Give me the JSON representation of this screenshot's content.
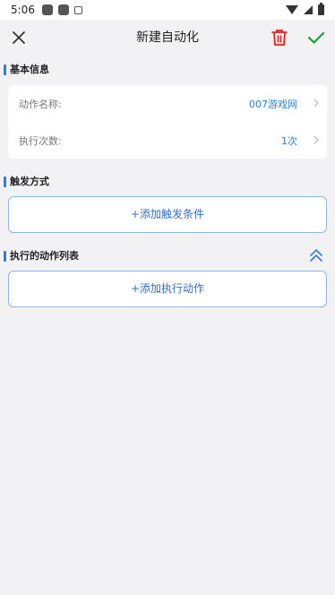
{
  "status_bar": {
    "time": "5:06"
  },
  "app_bar": {
    "title": "新建自动化"
  },
  "icons": {
    "close": "close-icon",
    "delete": "trash-icon",
    "confirm": "check-icon",
    "collapse": "double-chevron-up-icon"
  },
  "colors": {
    "accent": "#2f7de1",
    "delete": "#e02020",
    "confirm": "#1e9e3a"
  },
  "basic_info": {
    "section_title": "基本信息",
    "rows": [
      {
        "label": "动作名称:",
        "value": "007游戏网"
      },
      {
        "label": "执行次数:",
        "value": "1次"
      }
    ]
  },
  "trigger": {
    "section_title": "触发方式",
    "add_label": "+添加触发条件"
  },
  "actions": {
    "section_title": "执行的动作列表",
    "add_label": "+添加执行动作"
  }
}
